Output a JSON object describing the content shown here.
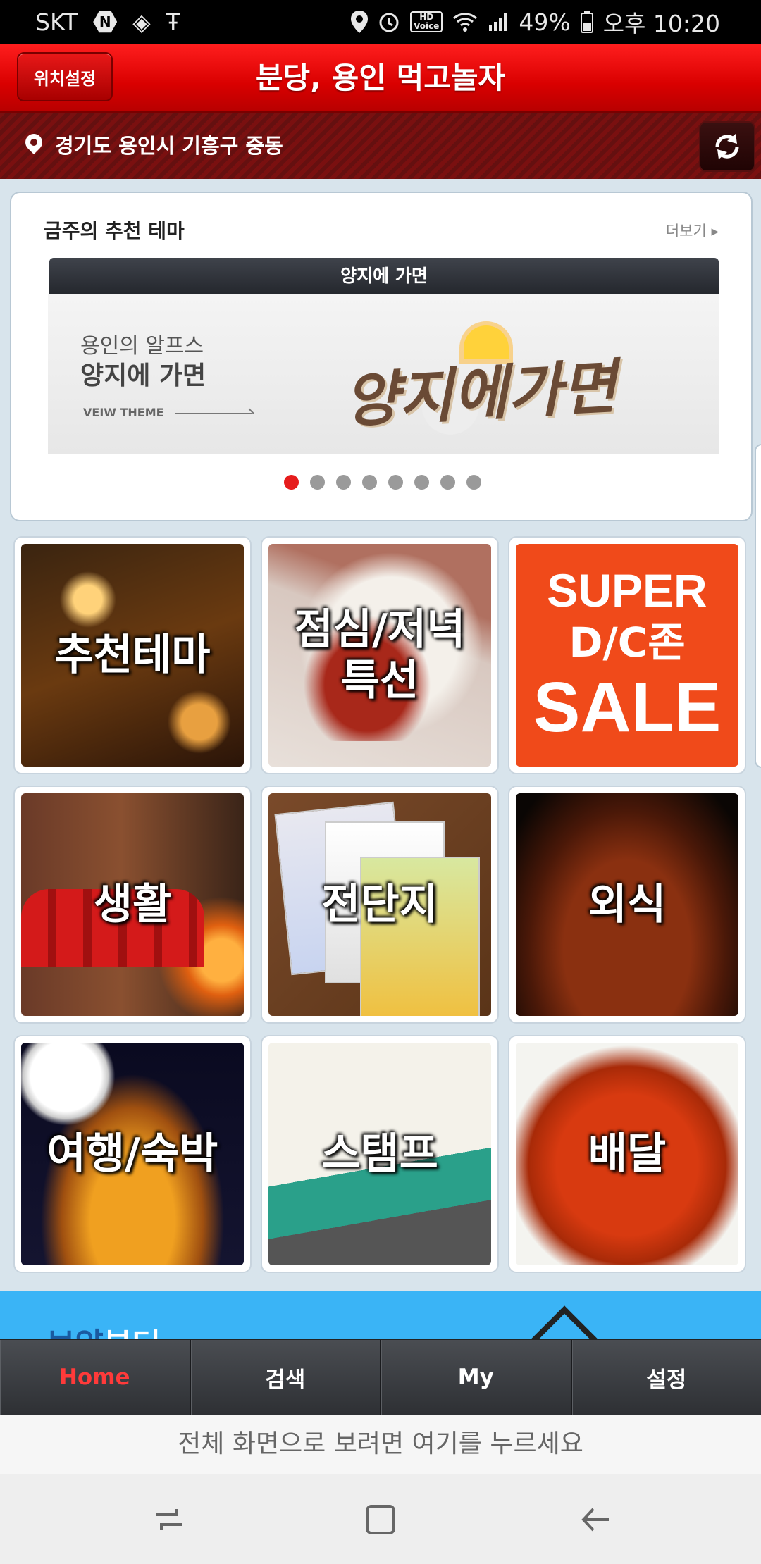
{
  "status_bar": {
    "carrier": "SKT",
    "battery": "49%",
    "time": "오후 10:20"
  },
  "header": {
    "location_button": "위치설정",
    "title": "분당, 용인 먹고놀자"
  },
  "location_bar": {
    "address": "경기도 용인시 기흥구 중동"
  },
  "theme_section": {
    "title": "금주의 추천 테마",
    "more": "더보기 ▸",
    "banner_title": "양지에 가면",
    "banner_subtitle": "용인의 알프스",
    "banner_main": "양지에 가면",
    "banner_view": "VEIW THEME",
    "banner_logo": "양지에가면",
    "slide_count": 8,
    "active_slide": 0
  },
  "tiles": [
    {
      "label": "추천테마"
    },
    {
      "label": "점심/저녁\n특선"
    },
    {
      "label": "SUPER D/C존 SALE",
      "line1": "SUPER",
      "line2": "D/C존",
      "line3": "SALE"
    },
    {
      "label": "생활"
    },
    {
      "label": "전단지"
    },
    {
      "label": "외식"
    },
    {
      "label": "여행/숙박"
    },
    {
      "label": "스탬프"
    },
    {
      "label": "배달"
    }
  ],
  "bottom_banner": {
    "text_strong": "보양",
    "text_rest": "부터"
  },
  "tab_bar": {
    "tabs": [
      "Home",
      "검색",
      "My",
      "설정"
    ],
    "active": "Home"
  },
  "fullscreen_prompt": "전체 화면으로 보려면 여기를 누르세요",
  "colors": {
    "header_red": "#e00000",
    "location_bar": "#6e1010",
    "active_tab": "#ff3a3a",
    "active_dot": "#e61c1c",
    "banner_blue": "#3ab4f6"
  }
}
